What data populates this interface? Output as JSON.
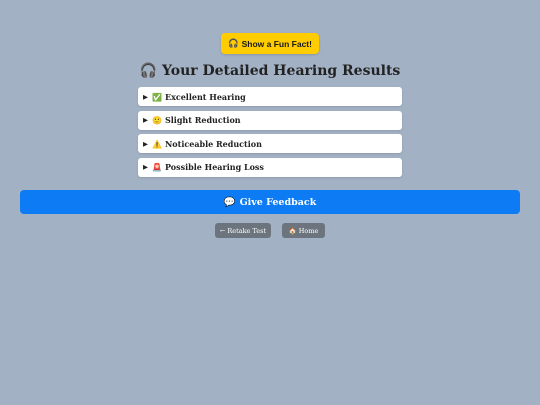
{
  "header": {
    "fun_fact_icon": "🎧",
    "fun_fact_label": "Show a Fun Fact!",
    "title_icon": "🎧",
    "title": "Your Detailed Hearing Results"
  },
  "results": {
    "items": [
      {
        "icon": "✅",
        "icon_name": "check-mark-icon",
        "label": "Excellent Hearing"
      },
      {
        "icon": "🙂",
        "icon_name": "slight-smile-icon",
        "label": "Slight Reduction"
      },
      {
        "icon": "⚠️",
        "icon_name": "warning-icon",
        "label": "Noticeable Reduction"
      },
      {
        "icon": "🚨",
        "icon_name": "siren-icon",
        "label": "Possible Hearing Loss"
      }
    ],
    "expand_glyph": "▶"
  },
  "feedback": {
    "icon": "💬",
    "label": "Give Feedback"
  },
  "nav": {
    "retake_icon": "←",
    "retake_label": "Retake Test",
    "home_icon": "🏠",
    "home_label": "Home"
  },
  "colors": {
    "background": "#a2b1c4",
    "fun_fact_button": "#ffcc00",
    "feedback_button": "#0d7bf4",
    "nav_button": "#6c757d"
  }
}
